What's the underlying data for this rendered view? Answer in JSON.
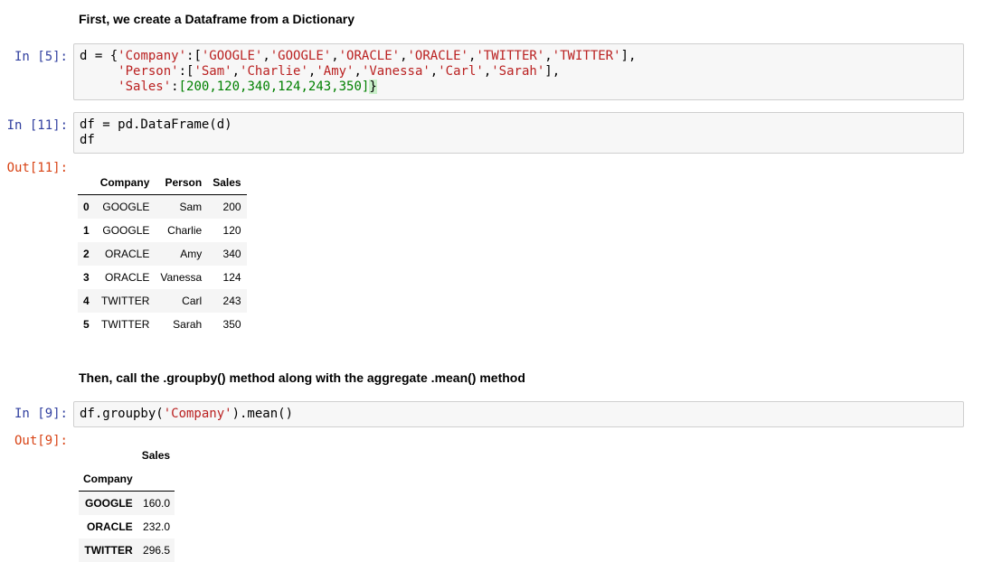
{
  "cells": {
    "md1": "First, we create a Dataframe from a Dictionary",
    "in5_prompt": "In [5]:",
    "in5_lines": [
      [
        [
          "p",
          "d = {"
        ],
        [
          "s",
          "'Company'"
        ],
        [
          "p",
          ":["
        ],
        [
          "s",
          "'GOOGLE'"
        ],
        [
          "p",
          ","
        ],
        [
          "s",
          "'GOOGLE'"
        ],
        [
          "p",
          ","
        ],
        [
          "s",
          "'ORACLE'"
        ],
        [
          "p",
          ","
        ],
        [
          "s",
          "'ORACLE'"
        ],
        [
          "p",
          ","
        ],
        [
          "s",
          "'TWITTER'"
        ],
        [
          "p",
          ","
        ],
        [
          "s",
          "'TWITTER'"
        ],
        [
          "p",
          "],"
        ]
      ],
      [
        [
          "p",
          "     "
        ],
        [
          "s",
          "'Person'"
        ],
        [
          "p",
          ":["
        ],
        [
          "s",
          "'Sam'"
        ],
        [
          "p",
          ","
        ],
        [
          "s",
          "'Charlie'"
        ],
        [
          "p",
          ","
        ],
        [
          "s",
          "'Amy'"
        ],
        [
          "p",
          ","
        ],
        [
          "s",
          "'Vanessa'"
        ],
        [
          "p",
          ","
        ],
        [
          "s",
          "'Carl'"
        ],
        [
          "p",
          ","
        ],
        [
          "s",
          "'Sarah'"
        ],
        [
          "p",
          "],"
        ]
      ],
      [
        [
          "p",
          "     "
        ],
        [
          "s",
          "'Sales'"
        ],
        [
          "p",
          ":"
        ],
        [
          "n",
          "[200,120,340,124,243,350]"
        ],
        [
          "h",
          "}"
        ]
      ]
    ],
    "in11_prompt": "In [11]:",
    "in11_code": "df = pd.DataFrame(d)\ndf",
    "out11_prompt": "Out[11]:",
    "df_table": {
      "columns": [
        "Company",
        "Person",
        "Sales"
      ],
      "rows": [
        {
          "idx": "0",
          "Company": "GOOGLE",
          "Person": "Sam",
          "Sales": "200"
        },
        {
          "idx": "1",
          "Company": "GOOGLE",
          "Person": "Charlie",
          "Sales": "120"
        },
        {
          "idx": "2",
          "Company": "ORACLE",
          "Person": "Amy",
          "Sales": "340"
        },
        {
          "idx": "3",
          "Company": "ORACLE",
          "Person": "Vanessa",
          "Sales": "124"
        },
        {
          "idx": "4",
          "Company": "TWITTER",
          "Person": "Carl",
          "Sales": "243"
        },
        {
          "idx": "5",
          "Company": "TWITTER",
          "Person": "Sarah",
          "Sales": "350"
        }
      ]
    },
    "md2": "Then, call the .groupby() method along with the aggregate .mean() method",
    "in9_prompt": "In [9]:",
    "in9_lines": [
      [
        [
          "p",
          "df.groupby("
        ],
        [
          "s",
          "'Company'"
        ],
        [
          "p",
          ").mean()"
        ]
      ]
    ],
    "out9_prompt": "Out[9]:",
    "group_table": {
      "column": "Sales",
      "index_name": "Company",
      "rows": [
        {
          "idx": "GOOGLE",
          "Sales": "160.0"
        },
        {
          "idx": "ORACLE",
          "Sales": "232.0"
        },
        {
          "idx": "TWITTER",
          "Sales": "296.5"
        }
      ]
    }
  },
  "colors": {
    "in_prompt": "#303f9f",
    "out_prompt": "#d84315",
    "string": "#ba2121",
    "number": "#008000",
    "code_bg": "#f7f7f7"
  }
}
